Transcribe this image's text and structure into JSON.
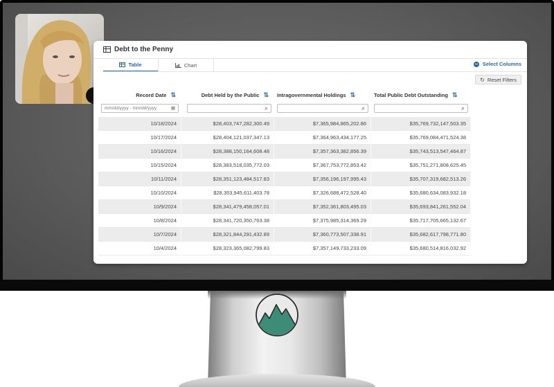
{
  "app": {
    "title": "Debt to the Penny"
  },
  "tabs": [
    {
      "label": "Table",
      "active": true
    },
    {
      "label": "Chart",
      "active": false
    }
  ],
  "toolbar": {
    "select_columns_label": "Select Columns",
    "reset_filters_label": "Reset Filters"
  },
  "table": {
    "columns": [
      {
        "label": "Record Date"
      },
      {
        "label": "Debt Held by the Public"
      },
      {
        "label": "Intragovernmental Holdings"
      },
      {
        "label": "Total Public Debt Outstanding"
      }
    ],
    "date_filter_placeholder": "mm/dd/yyyy - mm/dd/yyyy",
    "rows": [
      [
        "10/18/2024",
        "$28,403,747,282,300.49",
        "$7,365,984,865,202.86",
        "$35,769,732,147,503.35"
      ],
      [
        "10/17/2024",
        "$28,404,121,037,347.13",
        "$7,364,963,434,177.25",
        "$35,769,084,471,524.38"
      ],
      [
        "10/16/2024",
        "$28,388,150,164,608.48",
        "$7,357,363,382,856.39",
        "$35,743,513,547,464.87"
      ],
      [
        "10/15/2024",
        "$28,383,518,035,772.03",
        "$7,367,753,772,853.42",
        "$35,751,271,808,625.45"
      ],
      [
        "10/11/2024",
        "$28,351,123,484,517.83",
        "$7,356,196,197,995.43",
        "$35,707,319,682,513.26"
      ],
      [
        "10/10/2024",
        "$28,353,945,611,403.78",
        "$7,326,688,472,528.40",
        "$35,680,634,083,932.18"
      ],
      [
        "10/9/2024",
        "$28,341,479,458,057.01",
        "$7,352,361,803,495.03",
        "$35,693,841,261,552.04"
      ],
      [
        "10/8/2024",
        "$28,341,720,350,763.38",
        "$7,375,985,314,369.29",
        "$35,717,705,665,132.67"
      ],
      [
        "10/7/2024",
        "$28,321,844,291,432.89",
        "$7,360,773,507,338.91",
        "$35,682,617,798,771.80"
      ],
      [
        "10/4/2024",
        "$28,323,365,082,799.83",
        "$7,357,149,733,233.09",
        "$35,680,514,816,032.92"
      ]
    ]
  },
  "colors": {
    "accent": "#2a6aa8",
    "logo_green": "#3d8c77"
  },
  "icons": {
    "table_tab": "table-icon",
    "chart_tab": "bar-chart-icon",
    "select_columns": "circle-plus-icon",
    "reset": "refresh-icon",
    "search": "search-icon",
    "calendar": "calendar-icon",
    "sort": "sort-arrows-icon"
  }
}
